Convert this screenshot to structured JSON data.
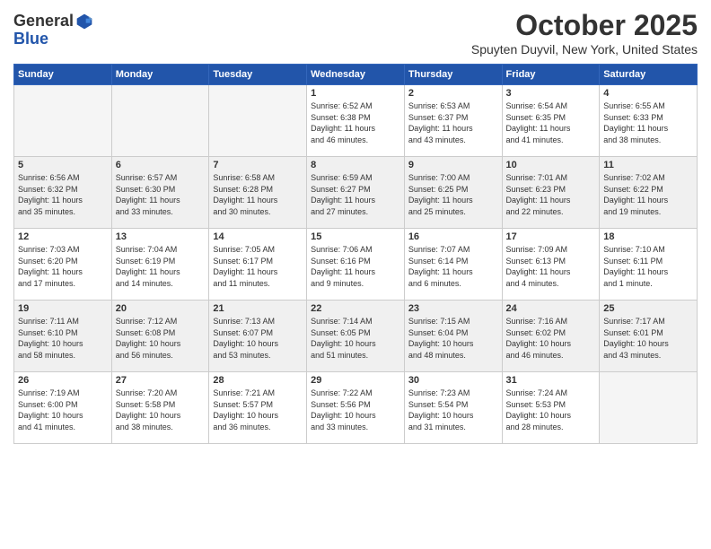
{
  "header": {
    "logo_general": "General",
    "logo_blue": "Blue",
    "month_title": "October 2025",
    "location": "Spuyten Duyvil, New York, United States"
  },
  "days_of_week": [
    "Sunday",
    "Monday",
    "Tuesday",
    "Wednesday",
    "Thursday",
    "Friday",
    "Saturday"
  ],
  "weeks": [
    [
      {
        "day": "",
        "info": ""
      },
      {
        "day": "",
        "info": ""
      },
      {
        "day": "",
        "info": ""
      },
      {
        "day": "1",
        "info": "Sunrise: 6:52 AM\nSunset: 6:38 PM\nDaylight: 11 hours\nand 46 minutes."
      },
      {
        "day": "2",
        "info": "Sunrise: 6:53 AM\nSunset: 6:37 PM\nDaylight: 11 hours\nand 43 minutes."
      },
      {
        "day": "3",
        "info": "Sunrise: 6:54 AM\nSunset: 6:35 PM\nDaylight: 11 hours\nand 41 minutes."
      },
      {
        "day": "4",
        "info": "Sunrise: 6:55 AM\nSunset: 6:33 PM\nDaylight: 11 hours\nand 38 minutes."
      }
    ],
    [
      {
        "day": "5",
        "info": "Sunrise: 6:56 AM\nSunset: 6:32 PM\nDaylight: 11 hours\nand 35 minutes."
      },
      {
        "day": "6",
        "info": "Sunrise: 6:57 AM\nSunset: 6:30 PM\nDaylight: 11 hours\nand 33 minutes."
      },
      {
        "day": "7",
        "info": "Sunrise: 6:58 AM\nSunset: 6:28 PM\nDaylight: 11 hours\nand 30 minutes."
      },
      {
        "day": "8",
        "info": "Sunrise: 6:59 AM\nSunset: 6:27 PM\nDaylight: 11 hours\nand 27 minutes."
      },
      {
        "day": "9",
        "info": "Sunrise: 7:00 AM\nSunset: 6:25 PM\nDaylight: 11 hours\nand 25 minutes."
      },
      {
        "day": "10",
        "info": "Sunrise: 7:01 AM\nSunset: 6:23 PM\nDaylight: 11 hours\nand 22 minutes."
      },
      {
        "day": "11",
        "info": "Sunrise: 7:02 AM\nSunset: 6:22 PM\nDaylight: 11 hours\nand 19 minutes."
      }
    ],
    [
      {
        "day": "12",
        "info": "Sunrise: 7:03 AM\nSunset: 6:20 PM\nDaylight: 11 hours\nand 17 minutes."
      },
      {
        "day": "13",
        "info": "Sunrise: 7:04 AM\nSunset: 6:19 PM\nDaylight: 11 hours\nand 14 minutes."
      },
      {
        "day": "14",
        "info": "Sunrise: 7:05 AM\nSunset: 6:17 PM\nDaylight: 11 hours\nand 11 minutes."
      },
      {
        "day": "15",
        "info": "Sunrise: 7:06 AM\nSunset: 6:16 PM\nDaylight: 11 hours\nand 9 minutes."
      },
      {
        "day": "16",
        "info": "Sunrise: 7:07 AM\nSunset: 6:14 PM\nDaylight: 11 hours\nand 6 minutes."
      },
      {
        "day": "17",
        "info": "Sunrise: 7:09 AM\nSunset: 6:13 PM\nDaylight: 11 hours\nand 4 minutes."
      },
      {
        "day": "18",
        "info": "Sunrise: 7:10 AM\nSunset: 6:11 PM\nDaylight: 11 hours\nand 1 minute."
      }
    ],
    [
      {
        "day": "19",
        "info": "Sunrise: 7:11 AM\nSunset: 6:10 PM\nDaylight: 10 hours\nand 58 minutes."
      },
      {
        "day": "20",
        "info": "Sunrise: 7:12 AM\nSunset: 6:08 PM\nDaylight: 10 hours\nand 56 minutes."
      },
      {
        "day": "21",
        "info": "Sunrise: 7:13 AM\nSunset: 6:07 PM\nDaylight: 10 hours\nand 53 minutes."
      },
      {
        "day": "22",
        "info": "Sunrise: 7:14 AM\nSunset: 6:05 PM\nDaylight: 10 hours\nand 51 minutes."
      },
      {
        "day": "23",
        "info": "Sunrise: 7:15 AM\nSunset: 6:04 PM\nDaylight: 10 hours\nand 48 minutes."
      },
      {
        "day": "24",
        "info": "Sunrise: 7:16 AM\nSunset: 6:02 PM\nDaylight: 10 hours\nand 46 minutes."
      },
      {
        "day": "25",
        "info": "Sunrise: 7:17 AM\nSunset: 6:01 PM\nDaylight: 10 hours\nand 43 minutes."
      }
    ],
    [
      {
        "day": "26",
        "info": "Sunrise: 7:19 AM\nSunset: 6:00 PM\nDaylight: 10 hours\nand 41 minutes."
      },
      {
        "day": "27",
        "info": "Sunrise: 7:20 AM\nSunset: 5:58 PM\nDaylight: 10 hours\nand 38 minutes."
      },
      {
        "day": "28",
        "info": "Sunrise: 7:21 AM\nSunset: 5:57 PM\nDaylight: 10 hours\nand 36 minutes."
      },
      {
        "day": "29",
        "info": "Sunrise: 7:22 AM\nSunset: 5:56 PM\nDaylight: 10 hours\nand 33 minutes."
      },
      {
        "day": "30",
        "info": "Sunrise: 7:23 AM\nSunset: 5:54 PM\nDaylight: 10 hours\nand 31 minutes."
      },
      {
        "day": "31",
        "info": "Sunrise: 7:24 AM\nSunset: 5:53 PM\nDaylight: 10 hours\nand 28 minutes."
      },
      {
        "day": "",
        "info": ""
      }
    ]
  ]
}
